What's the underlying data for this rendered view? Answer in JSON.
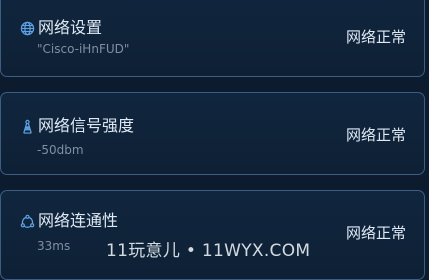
{
  "cards": [
    {
      "icon": "globe-icon",
      "title": "网络设置",
      "subtitle": "\"Cisco-iHnFUD\"",
      "status": "网络正常"
    },
    {
      "icon": "signal-tower-icon",
      "title": "网络信号强度",
      "subtitle": "-50dbm",
      "status": "网络正常"
    },
    {
      "icon": "connectivity-icon",
      "title": "网络连通性",
      "subtitle": "33ms",
      "status": "网络正常"
    }
  ],
  "watermark": "11玩意儿 • 11WYX.COM",
  "colors": {
    "background": "#0d1b2e",
    "card": "#10263e",
    "border": "#3d5d83",
    "icon": "#5fa3e6",
    "text": "#dfe9f5",
    "subtext": "#7e8fa6"
  }
}
